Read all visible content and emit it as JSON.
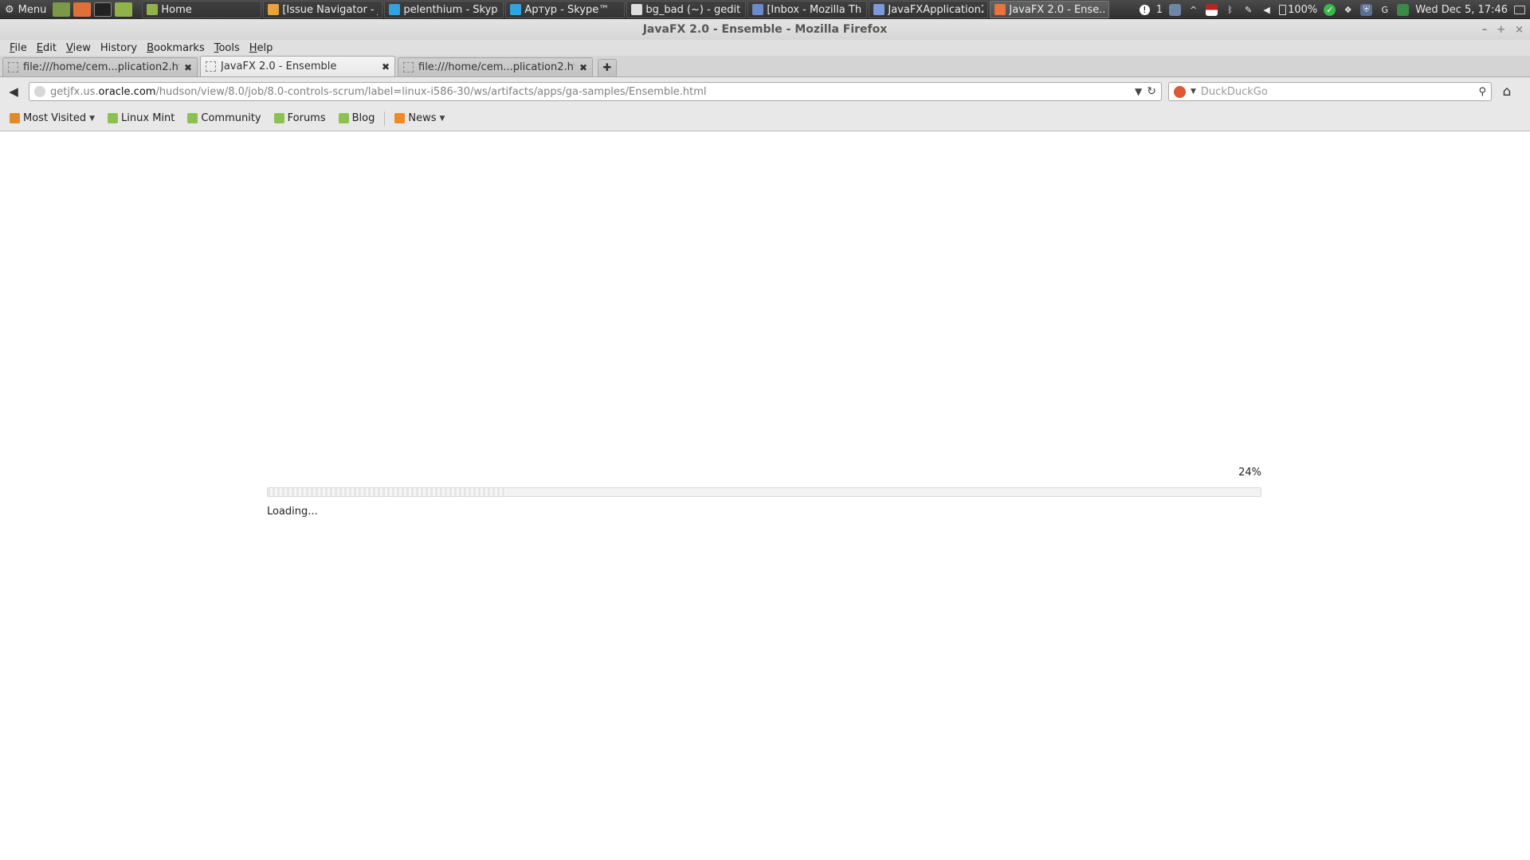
{
  "panel": {
    "menu_label": "Menu",
    "tasks": [
      {
        "label": "Home",
        "color": "#8fb34a"
      },
      {
        "label": "[Issue Navigator - J...",
        "color": "#e8a33c"
      },
      {
        "label": "pelenthium - Skyp...",
        "color": "#2fa4e0"
      },
      {
        "label": "Артур - Skype™",
        "color": "#2fa4e0"
      },
      {
        "label": "bg_bad (~) - gedit",
        "color": "#dddddd"
      },
      {
        "label": "[Inbox - Mozilla Th...",
        "color": "#6a8ac9"
      },
      {
        "label": "JavaFXApplication2...",
        "color": "#7a9ad8"
      },
      {
        "label": "JavaFX 2.0 - Ense...",
        "color": "#e8743c"
      }
    ],
    "tray": {
      "notification_count": "1",
      "battery": "100%",
      "clock": "Wed Dec  5, 17:46"
    }
  },
  "window": {
    "title": "JavaFX 2.0 - Ensemble - Mozilla Firefox",
    "controls": [
      "–",
      "+",
      "×"
    ]
  },
  "menubar": {
    "items": [
      {
        "mnemonic": "F",
        "rest": "ile"
      },
      {
        "mnemonic": "E",
        "rest": "dit"
      },
      {
        "mnemonic": "V",
        "rest": "iew"
      },
      {
        "mnemonic": "",
        "rest": "History"
      },
      {
        "mnemonic": "B",
        "rest": "ookmarks"
      },
      {
        "mnemonic": "T",
        "rest": "ools"
      },
      {
        "mnemonic": "H",
        "rest": "elp"
      }
    ]
  },
  "tabs": [
    {
      "label": "file:///home/cem...plication2.html",
      "selected": false
    },
    {
      "label": "JavaFX 2.0 - Ensemble",
      "selected": true
    },
    {
      "label": "file:///home/cem...plication2.html",
      "selected": false
    }
  ],
  "navbar": {
    "url_prefix": "getjfx.us.",
    "url_domain": "oracle.com",
    "url_path": "/hudson/view/8.0/job/8.0-controls-scrum/label=linux-i586-30/ws/artifacts/apps/ga-samples/Ensemble.html",
    "search_placeholder": "DuckDuckGo"
  },
  "bookmarks": [
    {
      "label": "Most Visited",
      "has_dropdown": true,
      "color": "#e08a2a"
    },
    {
      "label": "Linux Mint",
      "has_dropdown": false,
      "color": "#8cc152"
    },
    {
      "label": "Community",
      "has_dropdown": false,
      "color": "#8cc152"
    },
    {
      "label": "Forums",
      "has_dropdown": false,
      "color": "#8cc152"
    },
    {
      "label": "Blog",
      "has_dropdown": false,
      "color": "#8cc152"
    },
    {
      "label": "News",
      "has_dropdown": true,
      "color": "#f08a24"
    }
  ],
  "content": {
    "progress_percent": 24,
    "progress_label": "24%",
    "status_text": "Loading..."
  }
}
